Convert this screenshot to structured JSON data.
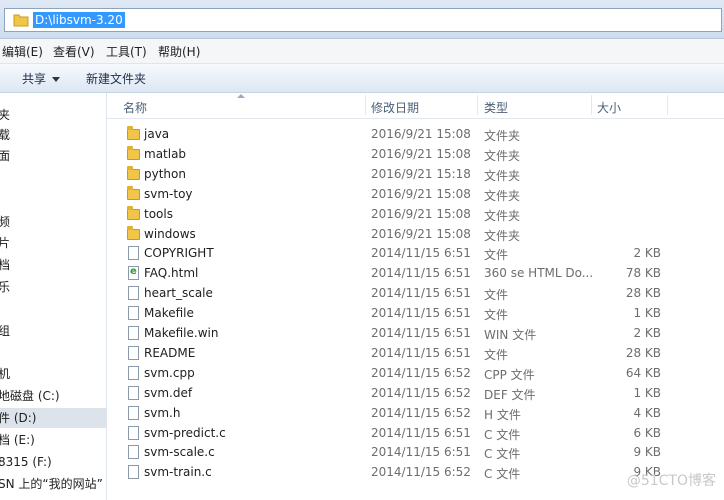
{
  "address": {
    "path": "D:\\libsvm-3.20"
  },
  "menu": [
    "编辑(E)",
    "查看(V)",
    "工具(T)",
    "帮助(H)"
  ],
  "toolbar": {
    "share": "共享",
    "new_folder": "新建文件夹"
  },
  "nav": [
    "夹",
    "载",
    "面",
    "频",
    "片",
    "档",
    "乐",
    "组",
    "机",
    "地磁盘 (C:)",
    "件 (D:)",
    "档 (E:)",
    "8315 (F:)",
    "SN 上的“我的网站”"
  ],
  "columns": {
    "name": "名称",
    "date": "修改日期",
    "type": "类型",
    "size": "大小"
  },
  "files": [
    {
      "name": "java",
      "date": "2016/9/21 15:08",
      "type": "文件夹",
      "size": "",
      "icon": "folder-icon"
    },
    {
      "name": "matlab",
      "date": "2016/9/21 15:08",
      "type": "文件夹",
      "size": "",
      "icon": "folder-icon"
    },
    {
      "name": "python",
      "date": "2016/9/21 15:18",
      "type": "文件夹",
      "size": "",
      "icon": "folder-icon"
    },
    {
      "name": "svm-toy",
      "date": "2016/9/21 15:08",
      "type": "文件夹",
      "size": "",
      "icon": "folder-icon"
    },
    {
      "name": "tools",
      "date": "2016/9/21 15:08",
      "type": "文件夹",
      "size": "",
      "icon": "folder-icon"
    },
    {
      "name": "windows",
      "date": "2016/9/21 15:08",
      "type": "文件夹",
      "size": "",
      "icon": "folder-icon"
    },
    {
      "name": "COPYRIGHT",
      "date": "2014/11/15 6:51",
      "type": "文件",
      "size": "2 KB",
      "icon": "file-icon"
    },
    {
      "name": "FAQ.html",
      "date": "2014/11/15 6:51",
      "type": "360 se HTML Do...",
      "size": "78 KB",
      "icon": "html-file-icon"
    },
    {
      "name": "heart_scale",
      "date": "2014/11/15 6:51",
      "type": "文件",
      "size": "28 KB",
      "icon": "file-icon"
    },
    {
      "name": "Makefile",
      "date": "2014/11/15 6:51",
      "type": "文件",
      "size": "1 KB",
      "icon": "file-icon"
    },
    {
      "name": "Makefile.win",
      "date": "2014/11/15 6:51",
      "type": "WIN 文件",
      "size": "2 KB",
      "icon": "file-icon"
    },
    {
      "name": "README",
      "date": "2014/11/15 6:51",
      "type": "文件",
      "size": "28 KB",
      "icon": "file-icon"
    },
    {
      "name": "svm.cpp",
      "date": "2014/11/15 6:52",
      "type": "CPP 文件",
      "size": "64 KB",
      "icon": "file-icon"
    },
    {
      "name": "svm.def",
      "date": "2014/11/15 6:52",
      "type": "DEF 文件",
      "size": "1 KB",
      "icon": "file-icon"
    },
    {
      "name": "svm.h",
      "date": "2014/11/15 6:52",
      "type": "H 文件",
      "size": "4 KB",
      "icon": "file-icon"
    },
    {
      "name": "svm-predict.c",
      "date": "2014/11/15 6:51",
      "type": "C 文件",
      "size": "6 KB",
      "icon": "file-icon"
    },
    {
      "name": "svm-scale.c",
      "date": "2014/11/15 6:51",
      "type": "C 文件",
      "size": "9 KB",
      "icon": "file-icon"
    },
    {
      "name": "svm-train.c",
      "date": "2014/11/15 6:52",
      "type": "C 文件",
      "size": "9 KB",
      "icon": "file-icon"
    }
  ],
  "watermark": "@51CTO博客"
}
